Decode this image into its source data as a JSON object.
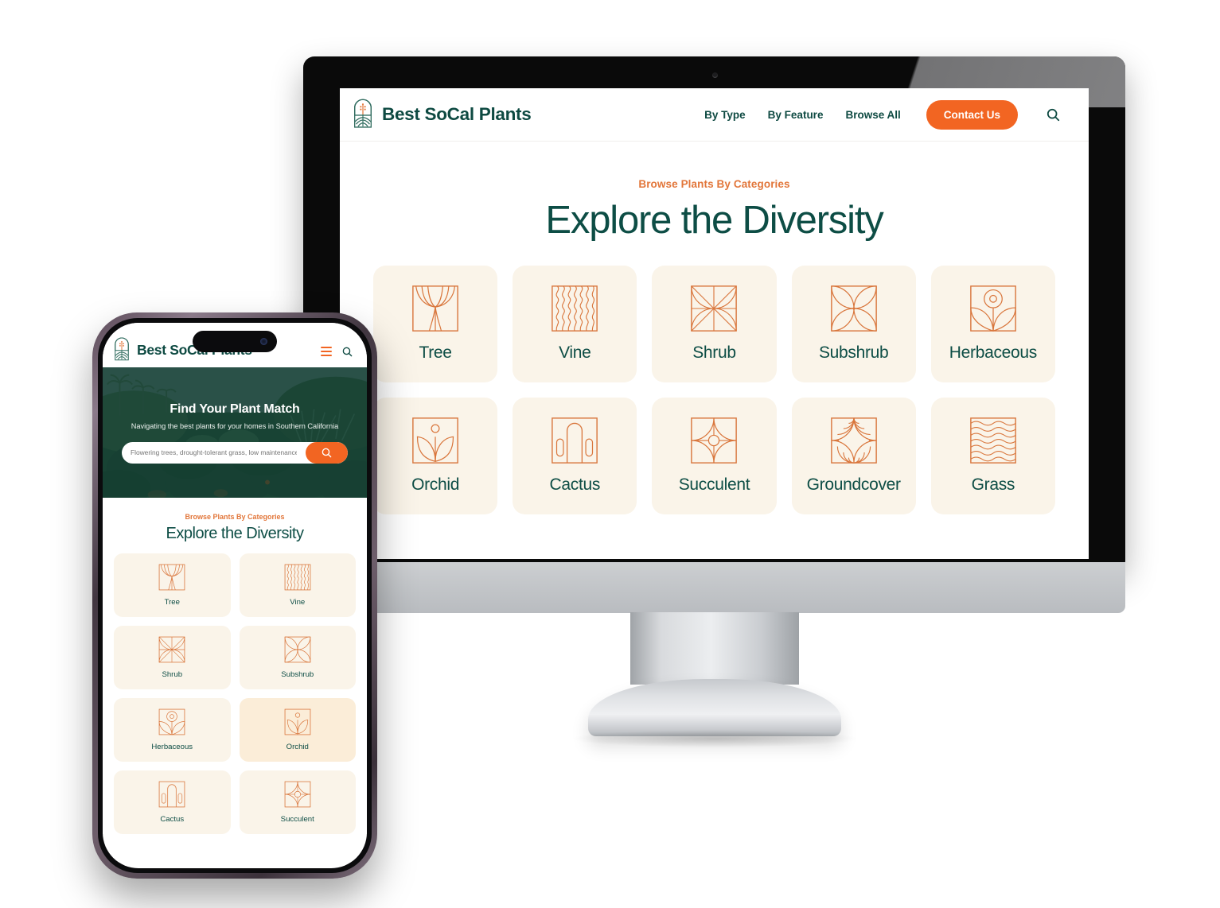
{
  "brand": {
    "name": "Best SoCal Plants",
    "logo_icon": "plant-arch-logo"
  },
  "colors": {
    "accent_orange": "#F26522",
    "eyebrow_orange": "#E2763A",
    "deep_green": "#0d4d45",
    "tile_cream": "#FAF4E9",
    "tile_cream_accent": "#FBEFDC"
  },
  "desktop": {
    "nav": [
      {
        "label": "By Type"
      },
      {
        "label": "By Feature"
      },
      {
        "label": "Browse All"
      }
    ],
    "contact_button": "Contact Us",
    "search_icon": "search-icon",
    "section": {
      "eyebrow": "Browse Plants By Categories",
      "heading": "Explore the Diversity"
    },
    "categories": [
      {
        "label": "Tree",
        "icon": "tree-icon"
      },
      {
        "label": "Vine",
        "icon": "vine-icon"
      },
      {
        "label": "Shrub",
        "icon": "shrub-icon"
      },
      {
        "label": "Subshrub",
        "icon": "subshrub-icon"
      },
      {
        "label": "Herbaceous",
        "icon": "herbaceous-icon"
      },
      {
        "label": "Orchid",
        "icon": "orchid-icon"
      },
      {
        "label": "Cactus",
        "icon": "cactus-icon"
      },
      {
        "label": "Succulent",
        "icon": "succulent-icon"
      },
      {
        "label": "Groundcover",
        "icon": "groundcover-icon"
      },
      {
        "label": "Grass",
        "icon": "grass-icon"
      }
    ]
  },
  "mobile": {
    "menu_icon": "hamburger-icon",
    "search_icon": "search-icon",
    "hero": {
      "title": "Find Your Plant Match",
      "subtitle": "Navigating the best plants for your homes in Southern California",
      "search_placeholder": "Flowering trees, drought-tolerant grass, low maintenance suc",
      "search_value": "",
      "search_button_icon": "search-icon"
    },
    "section": {
      "eyebrow": "Browse Plants By Categories",
      "heading": "Explore the Diversity"
    },
    "categories": [
      {
        "label": "Tree",
        "icon": "tree-icon"
      },
      {
        "label": "Vine",
        "icon": "vine-icon"
      },
      {
        "label": "Shrub",
        "icon": "shrub-icon"
      },
      {
        "label": "Subshrub",
        "icon": "subshrub-icon"
      },
      {
        "label": "Herbaceous",
        "icon": "herbaceous-icon"
      },
      {
        "label": "Orchid",
        "icon": "orchid-icon"
      },
      {
        "label": "Cactus",
        "icon": "cactus-icon"
      },
      {
        "label": "Succulent",
        "icon": "succulent-icon"
      }
    ]
  }
}
